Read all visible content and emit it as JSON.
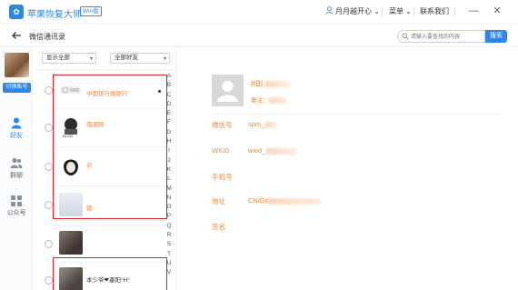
{
  "app": {
    "name": "苹果恢复大师",
    "edition_badge": "Win版"
  },
  "titlebar": {
    "username": "月月越开心",
    "menu_label": "菜单",
    "contact_label": "联系我们",
    "minimize": "—",
    "close": "✕"
  },
  "subheader": {
    "title": "微信通讯录",
    "search_placeholder": "请输入要查找的内容",
    "search_button": "搜索"
  },
  "leftnav": {
    "switch_account": "切换账号",
    "items": [
      {
        "label": "好友",
        "icon": "person-icon",
        "active": true
      },
      {
        "label": "群聊",
        "icon": "group-icon",
        "active": false
      },
      {
        "label": "公众号",
        "icon": "grid-icon",
        "active": false
      }
    ]
  },
  "list": {
    "filter_display": "显示全部",
    "filter_friends": "全部好友",
    "contacts": [
      {
        "name": "中国银行微银行",
        "style": "orange"
      },
      {
        "name": "南潮网",
        "style": "orange"
      },
      {
        "name": "卯",
        "style": "orange"
      },
      {
        "name": "蓉",
        "style": "orange"
      },
      {
        "name": "",
        "style": "dark"
      },
      {
        "name": "本少爷❤墨阳°H°",
        "style": "dark"
      }
    ],
    "alphabet": [
      "A",
      "B",
      "C",
      "D",
      "E",
      "F",
      "G",
      "H",
      "I",
      "J",
      "K",
      "L",
      "M",
      "N",
      "O",
      "P",
      "Q",
      "R",
      "S",
      "T",
      "U",
      "V"
    ]
  },
  "detail": {
    "name": "#Bl",
    "remark_label": "备注：",
    "fields": [
      {
        "label": "微信号",
        "value": "spm_"
      },
      {
        "label": "WXID",
        "value": "wxid_"
      },
      {
        "label": "手机号",
        "value": ""
      },
      {
        "label": "地址",
        "value": "CN/Gr"
      },
      {
        "label": "签名",
        "value": ""
      }
    ]
  },
  "colors": {
    "accent": "#2f86e6",
    "highlight": "#f0883a",
    "annotation_red": "#d9262c"
  }
}
